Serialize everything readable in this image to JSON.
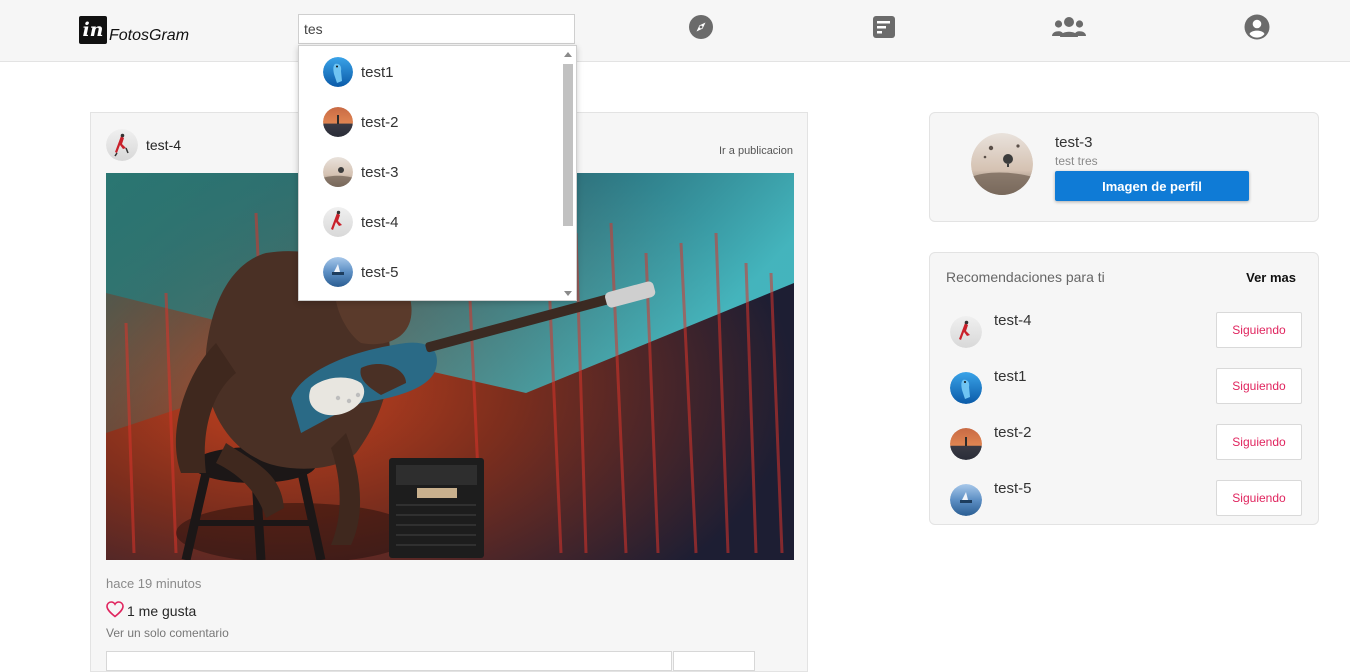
{
  "app": {
    "logo_mark": "in",
    "logo_text": "FotosGram"
  },
  "search": {
    "value": "tes",
    "placeholder": ""
  },
  "nav": {
    "icons": [
      "compass-icon",
      "feed-icon",
      "users-icon",
      "account-circle-icon"
    ]
  },
  "search_results": [
    {
      "name": "test1",
      "avatar": "blue-bird"
    },
    {
      "name": "test-2",
      "avatar": "sunset"
    },
    {
      "name": "test-3",
      "avatar": "balloons"
    },
    {
      "name": "test-4",
      "avatar": "runner"
    },
    {
      "name": "test-5",
      "avatar": "ocean"
    }
  ],
  "post": {
    "author": "test-4",
    "goto_label": "Ir a publicacion",
    "time": "hace 19 minutos",
    "likes": "1 me gusta",
    "comments_label": "Ver un solo comentario"
  },
  "profile": {
    "username": "test-3",
    "fullname": "test tres",
    "button_label": "Imagen de perfil"
  },
  "recommendations": {
    "title": "Recomendaciones para ti",
    "more_label": "Ver mas",
    "items": [
      {
        "name": "test-4",
        "button": "Siguiendo"
      },
      {
        "name": "test1",
        "button": "Siguiendo"
      },
      {
        "name": "test-2",
        "button": "Siguiendo"
      },
      {
        "name": "test-5",
        "button": "Siguiendo"
      }
    ]
  },
  "colors": {
    "primary": "#0f7bd6",
    "follow_text": "#e0245e",
    "like_heart": "#e0245e",
    "icon": "#6b6b6b"
  }
}
